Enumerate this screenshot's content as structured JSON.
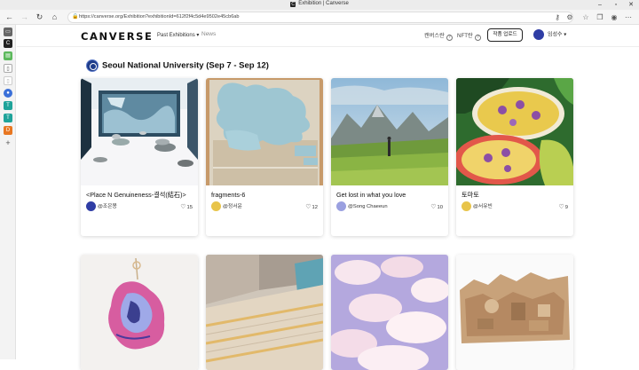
{
  "browser": {
    "window_title": "Exhibition | Canverse",
    "url": "https://canverse.org/Exhibition?exhibitionId=612f2f4c5d4e9502e45cb6ab"
  },
  "site": {
    "logo": "CANVERSE",
    "menu_past": "Past Exhibitions ▾",
    "menu_news": "News",
    "link_canverse": "캔버스란",
    "link_nft": "NFT란",
    "upload_button": "작품 업로드",
    "user_name": "임성수 ▾"
  },
  "exhibition": {
    "title": "Seoul National University (Sep 7 - Sep 12)"
  },
  "cards": [
    {
      "title": "<Place N Genuineness-결석(結石)>",
      "artist": "@조은봉",
      "likes": "15",
      "avatar_color": "#2f3da5"
    },
    {
      "title": "fragments-6",
      "artist": "@정서윤",
      "likes": "12",
      "avatar_color": "#e8c44a"
    },
    {
      "title": "Get lost in what you love",
      "artist": "@Song Chaeeun",
      "likes": "10",
      "avatar_color": "#9aa0e0"
    },
    {
      "title": "토마토",
      "artist": "@서유빈",
      "likes": "9",
      "avatar_color": "#e8c44a"
    }
  ]
}
